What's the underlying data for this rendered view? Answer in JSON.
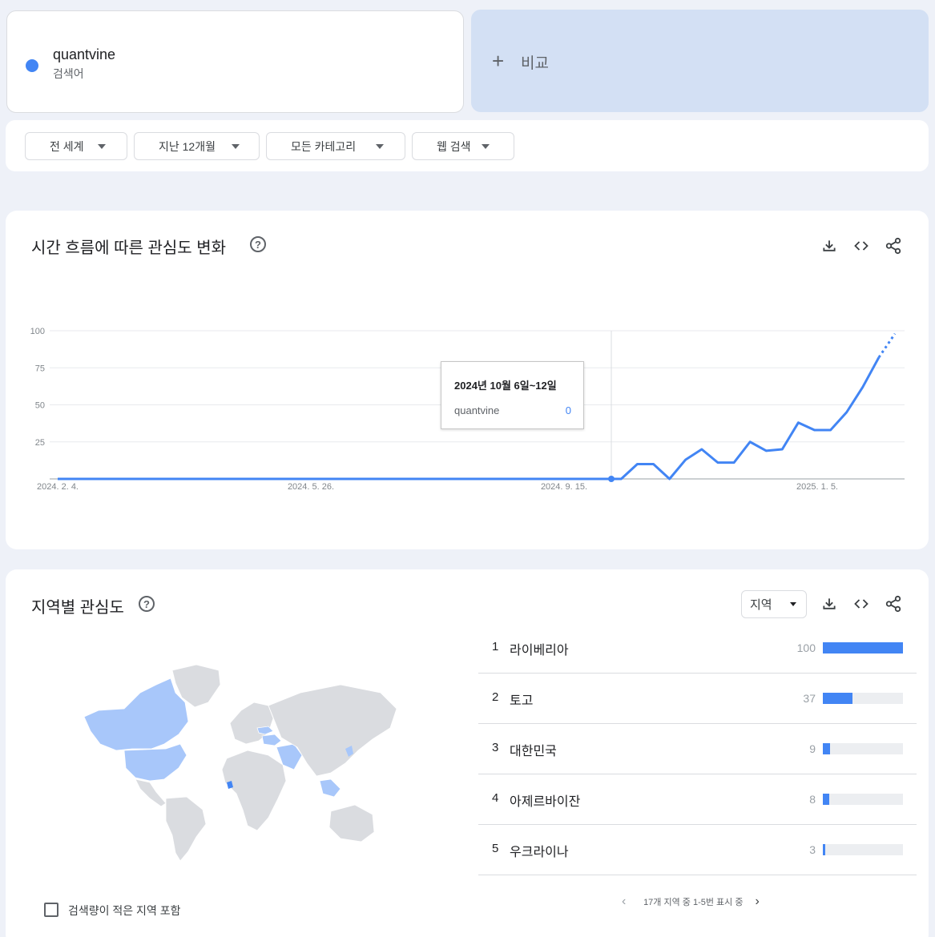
{
  "term": {
    "name": "quantvine",
    "sub": "검색어",
    "color": "#4285f4"
  },
  "compare": {
    "plus": "+",
    "label": "비교"
  },
  "filters": [
    {
      "label": "전 세계"
    },
    {
      "label": "지난 12개월"
    },
    {
      "label": "모든 카테고리"
    },
    {
      "label": "웹 검색"
    }
  ],
  "interest_over_time": {
    "title": "시간 흐름에 따른 관심도 변화",
    "help": "?",
    "tooltip": {
      "date": "2024년 10월 6일~12일",
      "term": "quantvine",
      "value": "0"
    }
  },
  "chart_data": {
    "type": "line",
    "y_ticks": [
      "100",
      "75",
      "50",
      "25"
    ],
    "x_ticks": [
      "2024. 2. 4.",
      "2024. 5. 26.",
      "2024. 9. 15.",
      "2025. 1. 5."
    ],
    "ylim": [
      0,
      100
    ],
    "series": [
      {
        "name": "quantvine",
        "color": "#4285f4",
        "values": [
          0,
          0,
          0,
          0,
          0,
          0,
          0,
          0,
          0,
          0,
          0,
          0,
          0,
          0,
          0,
          0,
          0,
          0,
          0,
          0,
          0,
          0,
          0,
          0,
          0,
          0,
          0,
          0,
          0,
          0,
          0,
          0,
          0,
          0,
          0,
          0,
          10,
          10,
          0,
          13,
          20,
          11,
          11,
          25,
          19,
          20,
          38,
          33,
          33,
          45,
          62,
          82,
          98
        ]
      }
    ],
    "partial_last_points": 2
  },
  "interest_by_region": {
    "title": "지역별 관심도",
    "help": "?",
    "select": "지역",
    "regions": [
      {
        "rank": "1",
        "name": "라이베리아",
        "value": "100",
        "fraction": 1.0
      },
      {
        "rank": "2",
        "name": "토고",
        "value": "37",
        "fraction": 0.37
      },
      {
        "rank": "3",
        "name": "대한민국",
        "value": "9",
        "fraction": 0.09
      },
      {
        "rank": "4",
        "name": "아제르바이잔",
        "value": "8",
        "fraction": 0.08
      },
      {
        "rank": "5",
        "name": "우크라이나",
        "value": "3",
        "fraction": 0.03
      }
    ],
    "pager": "17개 지역 중 1-5번 표시 중",
    "low_volume_label": "검색량이 적은 지역 포함"
  },
  "icons": [
    "download-icon",
    "embed-icon",
    "share-icon",
    "help-icon",
    "chevron-left-icon",
    "chevron-right-icon",
    "caret-down-icon"
  ]
}
